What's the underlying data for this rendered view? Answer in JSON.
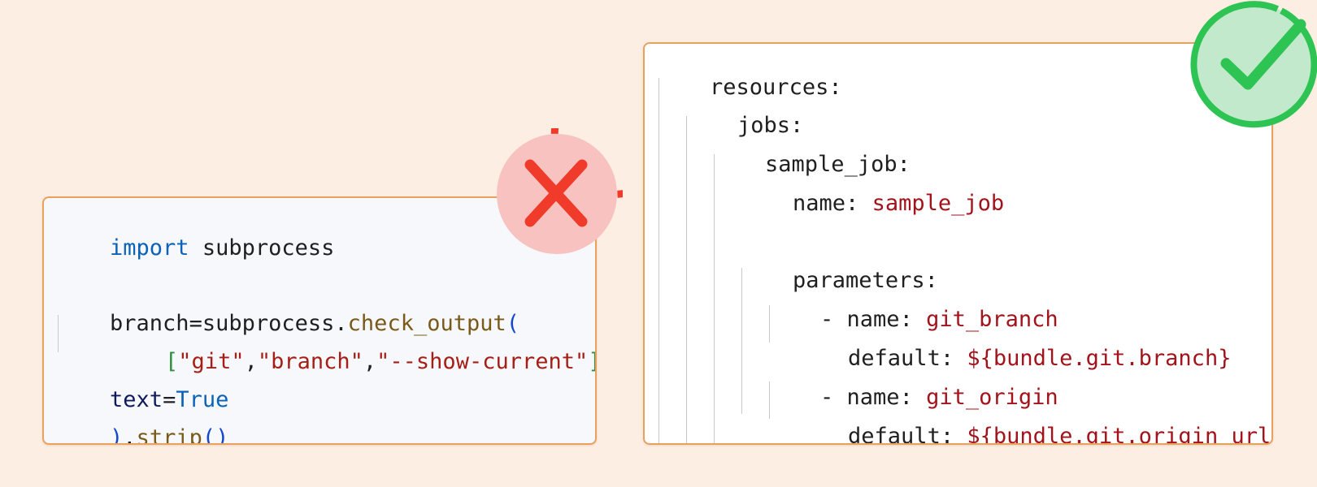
{
  "left_code": {
    "lines": [
      {
        "parts": [
          "import",
          " subprocess"
        ]
      },
      {
        "parts": []
      },
      {
        "parts": [
          "branch",
          "=",
          "subprocess",
          ".",
          "check_output",
          "("
        ]
      },
      {
        "parts": [
          "[",
          "\"git\"",
          ",",
          "\"branch\"",
          ",",
          "\"--show-current\"",
          "]",
          ","
        ]
      },
      {
        "parts": [
          "text",
          "=",
          "True"
        ]
      },
      {
        "parts": [
          ")",
          ".",
          "strip",
          "(",
          ")"
        ]
      }
    ]
  },
  "right_code": {
    "lines": [
      {
        "key": "resources:",
        "value": ""
      },
      {
        "key": "jobs:",
        "value": ""
      },
      {
        "key": "sample_job:",
        "value": ""
      },
      {
        "key": "name: ",
        "value": "sample_job"
      },
      {
        "key": "",
        "value": ""
      },
      {
        "key": "parameters:",
        "value": ""
      },
      {
        "key": "- name: ",
        "value": "git_branch"
      },
      {
        "key": "default: ",
        "value": "${bundle.git.branch}"
      },
      {
        "key": "- name: ",
        "value": "git_origin"
      },
      {
        "key": "default: ",
        "value": "${bundle.git.origin_url}"
      }
    ]
  },
  "badges": {
    "incorrect_icon": "x-mark-icon",
    "correct_icon": "check-mark-icon",
    "incorrect_color": "#f03a2a",
    "correct_color": "#2ec454"
  }
}
